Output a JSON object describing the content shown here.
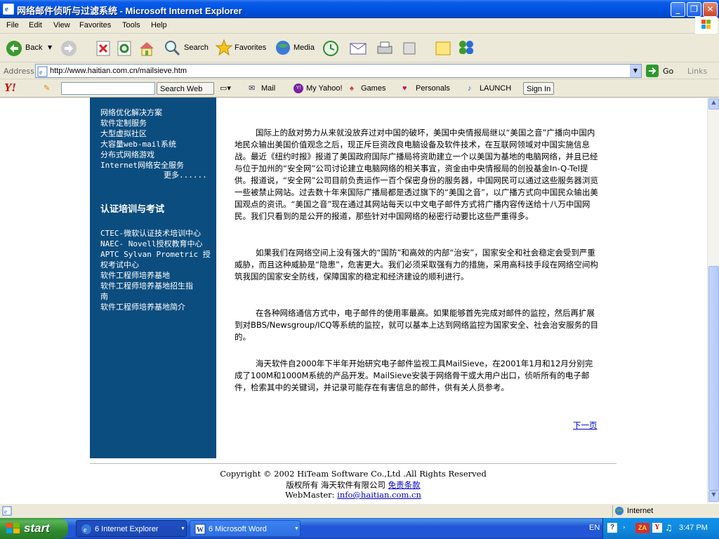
{
  "window": {
    "title": "网络邮件侦听与过滤系统 - Microsoft Internet Explorer",
    "minimize_symbol": "_",
    "maximize_symbol": "❐",
    "close_symbol": "✕"
  },
  "menu": [
    "File",
    "Edit",
    "View",
    "Favorites",
    "Tools",
    "Help"
  ],
  "toolbar": {
    "back": "Back",
    "search": "Search",
    "favorites": "Favorites",
    "media": "Media"
  },
  "address": {
    "label": "Address",
    "url": "http://www.haitian.com.cn/mailsieve.htm",
    "go": "Go",
    "links": "Links"
  },
  "yahoo": {
    "logo": "Y!",
    "search_value": "",
    "search_button": "Search Web",
    "mail": "Mail",
    "my_yahoo": "My Yahoo!",
    "games": "Games",
    "personals": "Personals",
    "launch": "LAUNCH",
    "sign_in": "Sign In"
  },
  "sidebar": {
    "links_top": [
      "网络优化解决方案",
      "软件定制服务",
      "大型虚拟社区",
      "大容量web-mail系统",
      "分布式网络游戏",
      "Internet网络安全服务"
    ],
    "more": "更多......",
    "heading": "认证培训与考试",
    "links_bottom": [
      "CTEC-微软认证技术培训中心",
      "NAEC- Novell授权教育中心",
      "APTC Sylvan Prometric 授",
      "权考试中心",
      "软件工程师培养基地",
      "软件工程师培养基地招生指",
      "南",
      "软件工程师培养基地简介"
    ]
  },
  "article": {
    "paragraphs": [
      "国际上的敌对势力从来就没放弃过对中国的破坏，美国中央情报局继以“美国之音”广播向中国内地民众输出美国价值观念之后，现正斥巨资改良电脑设备及软件技术，在互联网领域对中国实施信息战。最近《纽约时报》报道了美国政府国际广播局将资助建立一个以美国为基地的电脑网络，并且已经与位于加州的“安全网”公司讨论建立电脑网络的相关事宜，资金由中央情报局的创投基金In-Q-Tel提供。报道说，“安全网”公司目前负责运作一百个保密身份的服务器，中国网民可以通过这些服务器浏览一些被禁止网站。过去数十年来国际广播局都是透过旗下的“美国之音”，以广播方式向中国民众输出美国观点的资讯。“美国之音”现在通过其网站每天以中文电子邮件方式将广播内容传送给十八万中国网民。我们只看到的是公开的报道，那些针对中国网络的秘密行动要比这些严重得多。",
      "如果我们在网络空间上没有强大的“国防”和高效的内部“治安”，国家安全和社会稳定会受到严重威胁，而且这种威胁是“隐患”，危害更大。我们必须采取强有力的措施，采用高科技手段在网络空间构筑我国的国家安全防线，保障国家的稳定和经济建设的顺利进行。",
      "在各种网络通信方式中，电子邮件的使用率最高。如果能够首先完成对邮件的监控，然后再扩展到对BBS/Newsgroup/ICQ等系统的监控，就可以基本上达到网络监控为国家安全、社会治安服务的目的。",
      "海天软件自2000年下半年开始研究电子邮件监视工具MailSieve，在2001年1月和12月分别完成了100M和1000M系统的产品开发。MailSieve安装于网络骨干或大用户出口，侦听所有的电子邮件，检索其中的关键词，并记录可能存在有害信息的邮件，供有关人员参考。"
    ],
    "next_page": "下一页"
  },
  "footer": {
    "copyright": "Copyright © 2002 HiTeam Software Co.,Ltd .All Rights Reserved",
    "rights": "版权所有  海天软件有限公司 ",
    "disclaimer": "免责条款",
    "webmaster_label": "WebMaster: ",
    "webmaster_email": "info@haitian.com.cn"
  },
  "status": {
    "zone": "Internet"
  },
  "taskbar": {
    "start": "start",
    "tasks": [
      "6 Internet Explorer",
      "6 Microsoft Word"
    ],
    "lang": "EN",
    "clock": "3:47 PM"
  }
}
